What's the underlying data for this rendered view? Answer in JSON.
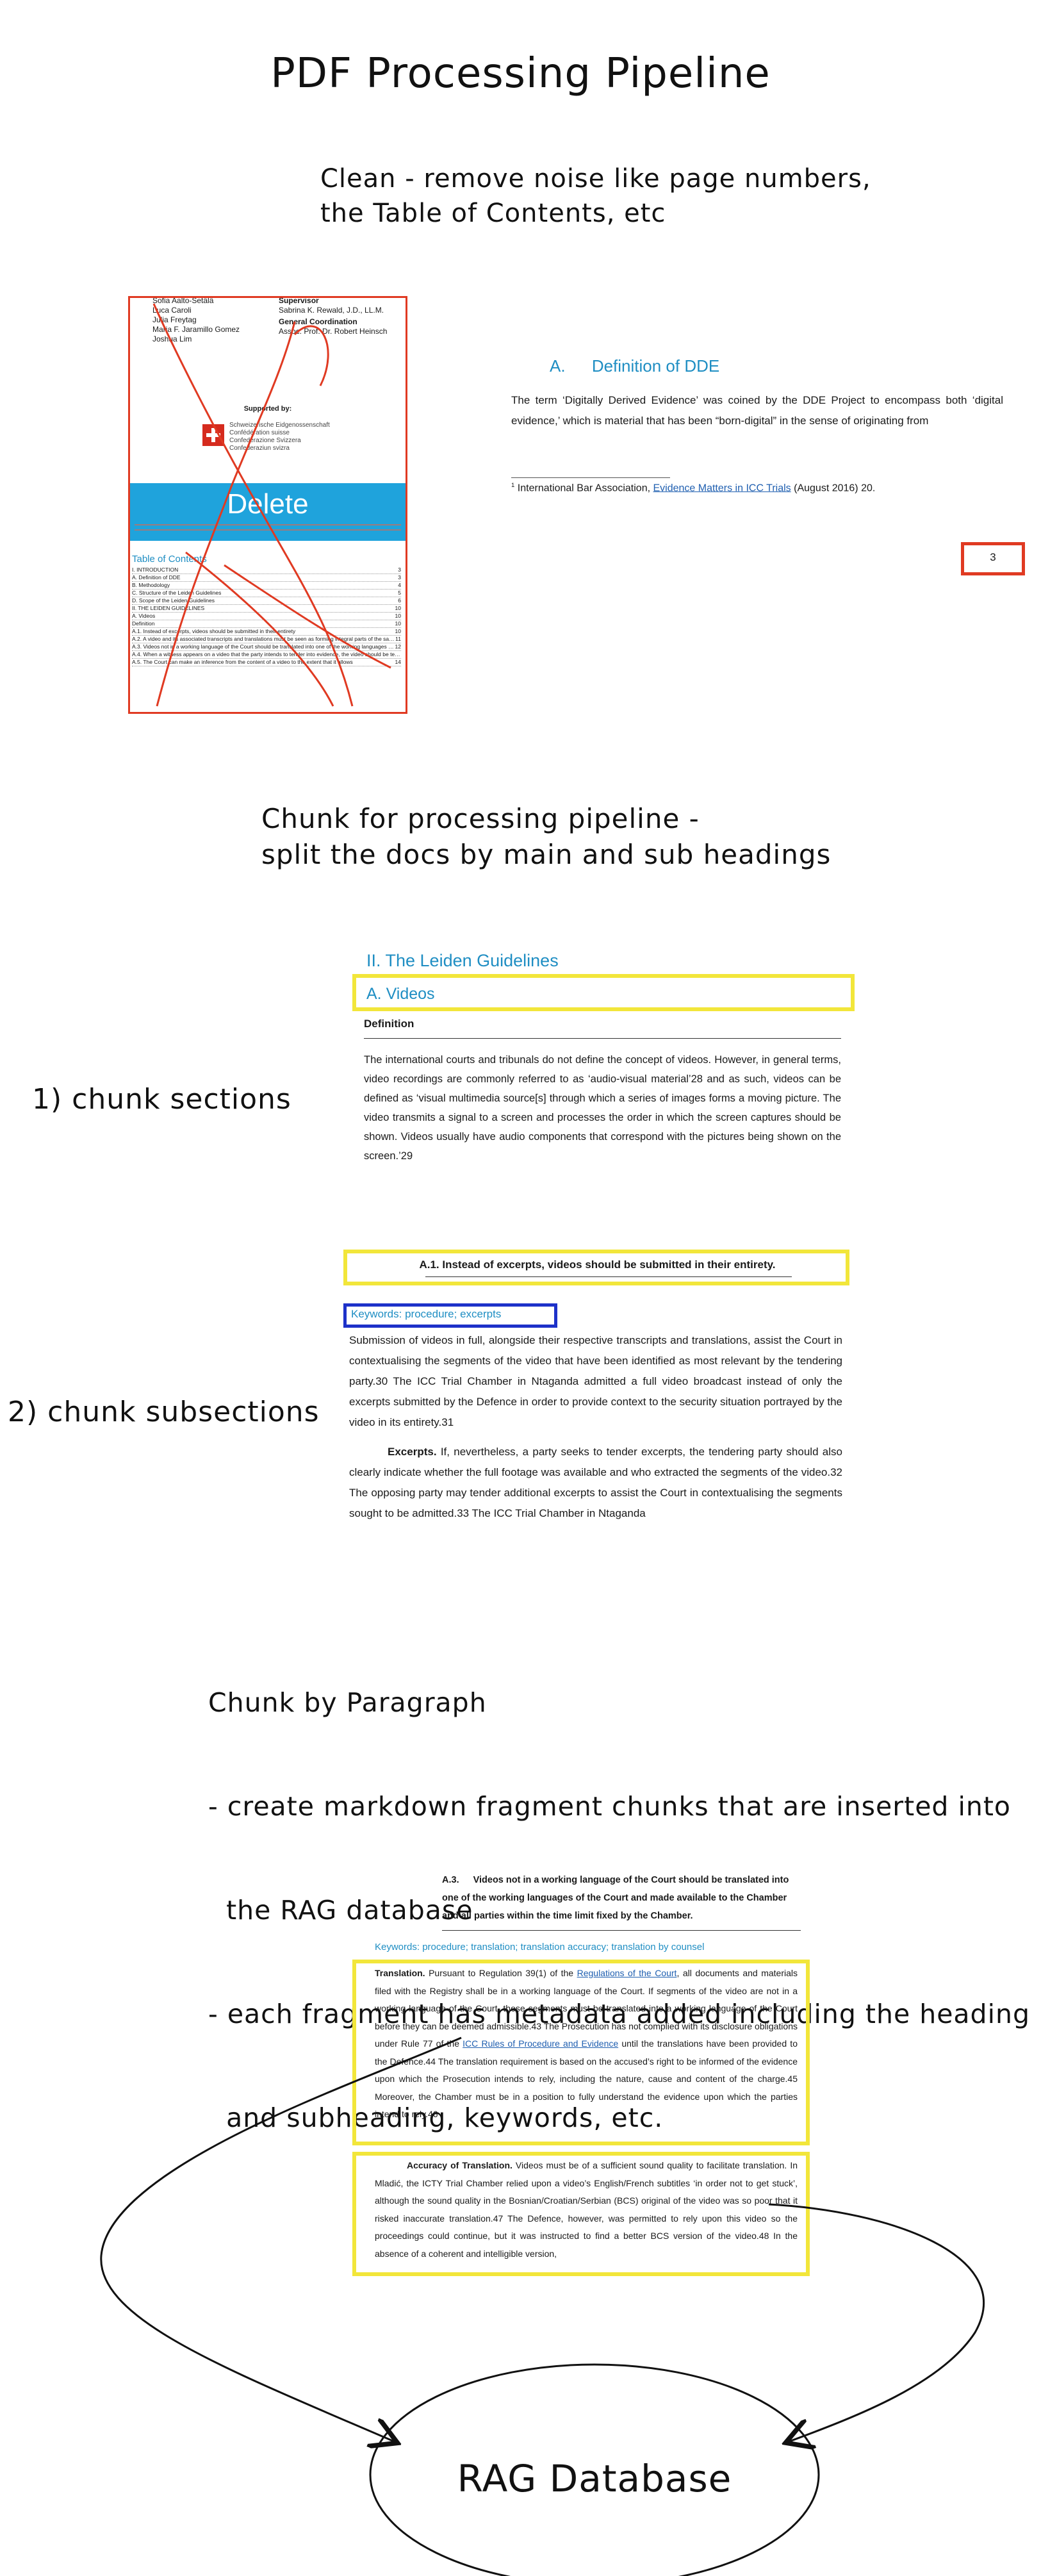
{
  "title": "PDF Processing Pipeline",
  "step_clean": {
    "text_line1": "Clean - remove noise like page numbers,",
    "text_line2": "the Table of Contents, etc",
    "thumb": {
      "col1": [
        "Sofia Aalto-Setälä",
        "Luca Caroli",
        "Julia Freytag",
        "Maria F. Jaramillo Gomez",
        "Joshua Lim"
      ],
      "col2_head": "Supervisor",
      "col2_line": "Sabrina K. Rewald, J.D., LL.M.",
      "col2_head2": "General Coordination",
      "col2_line2": "Assoc. Prof. Dr. Robert Heinsch",
      "supported_by": "Supported by:",
      "swiss_lines": [
        "Schweizerische Eidgenossenschaft",
        "Confédération suisse",
        "Confederazione Svizzera",
        "Confederaziun svizra"
      ],
      "delete_label": "Delete",
      "toc_title": "Table of Contents",
      "toc_items": [
        "I. INTRODUCTION",
        "A. Definition of DDE",
        "B. Methodology",
        "C. Structure of the Leiden Guidelines",
        "D. Scope of the Leiden Guidelines",
        "II. THE LEIDEN GUIDELINES",
        "A. Videos",
        "Definition",
        "A.1. Instead of excerpts, videos should be submitted in their entirety",
        "A.2. A video and its associated transcripts and translations must be seen as forming integral parts of the same evidence",
        "A.3. Videos not in a working language of the Court should be translated into one of the working languages of the Court and made available to the Chamber and all parties within the time limit fixed by the Chamber",
        "A.4. When a witness appears on a video that the party intends to tender into evidence, the video should be tendered through the witness during the proceedings, shall not go through the bar table",
        "A.5. The Court can make an inference from the content of a video to the extent that it allows"
      ],
      "toc_pages": [
        "3",
        "3",
        "4",
        "5",
        "6",
        "10",
        "10",
        "10",
        "10",
        "11",
        "12",
        "",
        "14",
        ""
      ]
    },
    "page_heading_letter": "A.",
    "page_heading": "Definition of DDE",
    "page_body": "The term ‘Digitally Derived Evidence’ was coined by the DDE Project to encompass both ‘digital evidence,’ which is material that has been “born-digital” in the sense of originating from",
    "footnote_num": "1",
    "footnote_pre": "International Bar Association, ",
    "footnote_link": "Evidence Matters in ICC Trials",
    "footnote_post": " (August 2016) 20.",
    "page_number": "3"
  },
  "step_chunk": {
    "text_line1": "Chunk for processing pipeline -",
    "text_line2": "split the docs by main and sub headings",
    "label1": "1) chunk sections",
    "label2": "2) chunk subsections",
    "section_heading": "II.   The Leiden Guidelines",
    "sub_heading": "A.    Videos",
    "definition_label": "Definition",
    "definition_body": "The international courts and tribunals do not define the concept of videos. However, in general terms, video recordings are commonly referred to as ‘audio-visual material’28 and as such, videos can be defined as ‘visual multimedia source[s] through which a series of images forms a moving picture. The video transmits a signal to a screen and processes the order in which the screen captures should be shown. Videos usually have audio components that correspond with the pictures being shown on the screen.’29",
    "a1_heading": "A.1.     Instead of excerpts, videos should be submitted in their entirety.",
    "keywords1": "Keywords: procedure; excerpts",
    "a1_para1": "Submission of videos in full, alongside their respective transcripts and translations, assist the Court in contextualising the segments of the video that have been identified as most relevant by the tendering party.30 The ICC Trial Chamber in Ntaganda admitted a full video broadcast instead of only the excerpts submitted by the Defence in order to provide context to the security situation portrayed by the video in its entirety.31",
    "a1_para2_lead": "Excerpts.",
    "a1_para2": " If, nevertheless, a party seeks to tender excerpts, the tendering party should also clearly indicate whether the full footage was available and who extracted the segments of the video.32 The opposing party may tender additional excerpts to assist the Court in contextualising the segments sought to be admitted.33 The ICC Trial Chamber in Ntaganda"
  },
  "step_paragraph": {
    "line1": "Chunk by Paragraph",
    "line2": "- create markdown fragment chunks that are inserted into",
    "line3": "  the RAG database",
    "line4": "- each fragment has metadata added including the heading",
    "line5": "  and subheading, keywords, etc.",
    "a3_num": "A.3.",
    "a3_heading": "Videos not in a working language of the Court should be translated into one of the working languages of the Court and made available to the Chamber and all parties within the time limit fixed by the Chamber.",
    "keywords3": "Keywords: procedure; translation; translation accuracy; translation by counsel",
    "para1_lead": "Translation.",
    "para1_a": " Pursuant to Regulation 39(1) of the ",
    "para1_link1": "Regulations of the Court",
    "para1_b": ", all documents and materials filed with the Registry shall be in a working language of the Court. If segments of the video are not in a working language of the Court, those segments must be translated into a working language of the Court before they can be deemed admissible.43 The Prosecution has not complied with its disclosure obligations under Rule 77 of the ",
    "para1_link2": "ICC Rules of Procedure and Evidence",
    "para1_c": " until the translations have been provided to the Defence.44 The translation requirement is based on the accused’s right to be informed of the evidence upon which the Prosecution intends to rely, including the nature, cause and content of the charge.45 Moreover, the Chamber must be in a position to fully understand the evidence upon which the parties intend to rely.46",
    "para2_lead": "Accuracy of Translation.",
    "para2": " Videos must be of a sufficient sound quality to facilitate translation. In Mladić, the ICTY Trial Chamber relied upon a video’s English/French subtitles ‘in order not to get stuck’, although the sound quality in the Bosnian/Croatian/Serbian (BCS) original of the video was so poor that it risked inaccurate translation.47 The Defence, however, was permitted to rely upon this video so the proceedings could continue, but it was instructed to find a better BCS version of the video.48 In the absence of a coherent and intelligible version,",
    "database_label": "RAG Database"
  },
  "colors": {
    "yellow": "#f2e63a",
    "red": "#e03a22",
    "blue_box": "#1d31c9",
    "heading_blue": "#1f8ec3",
    "delete_band": "#1fa3dc"
  }
}
